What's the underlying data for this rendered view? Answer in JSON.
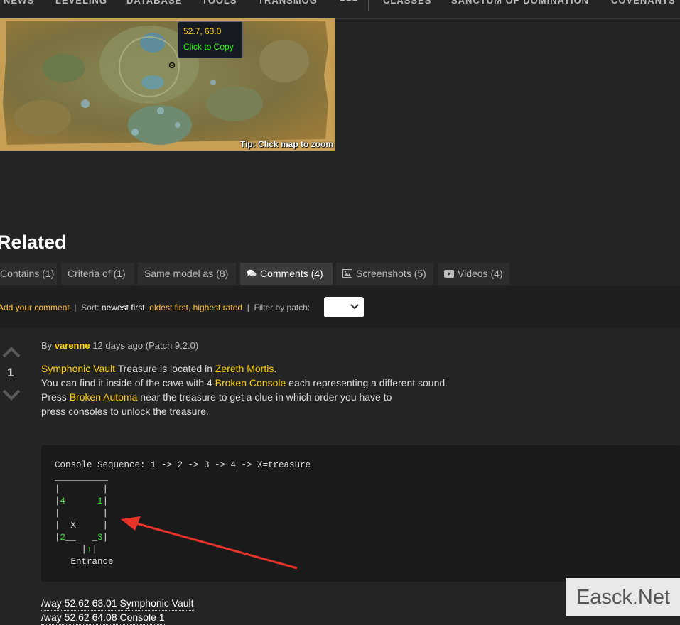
{
  "nav": {
    "items": [
      "NEWS",
      "LEVELING",
      "DATABASE",
      "TOOLS",
      "TRANSMOG",
      "CLASSES",
      "SANCTUM OF DOMINATION",
      "COVENANTS"
    ]
  },
  "map": {
    "tooltip_coords": "52.7, 63.0",
    "tooltip_action": "Click to Copy",
    "tip": "Tip: Click map to zoom"
  },
  "related": {
    "title": "Related",
    "tabs": [
      {
        "label": "Contains (1)",
        "icon": ""
      },
      {
        "label": "Criteria of (1)",
        "icon": ""
      },
      {
        "label": "Same model as (8)",
        "icon": ""
      },
      {
        "label": "Comments (4)",
        "icon": "comments-icon",
        "active": true
      },
      {
        "label": "Screenshots (5)",
        "icon": "image-icon"
      },
      {
        "label": "Videos (4)",
        "icon": "video-icon"
      }
    ]
  },
  "toolbar": {
    "add_comment": "Add your comment",
    "sort_label": "Sort:",
    "sort_newest": "newest first",
    "sort_oldest": "oldest first",
    "sort_highest": "highest rated",
    "filter_label": "Filter by patch:",
    "patch_value": ""
  },
  "comment": {
    "votes": "1",
    "by": "By",
    "author": "varenne",
    "meta": "12 days ago (Patch 9.2.0)",
    "lines": [
      {
        "parts": [
          {
            "t": "Symphonic Vault",
            "link": true
          },
          {
            "t": " Treasure is located in "
          },
          {
            "t": "Zereth Mortis",
            "link": true
          },
          {
            "t": "."
          }
        ]
      },
      {
        "parts": [
          {
            "t": "You can find it inside of the cave with 4 "
          },
          {
            "t": "Broken Console",
            "link": true
          },
          {
            "t": " each representing a different sound."
          }
        ]
      },
      {
        "parts": [
          {
            "t": "Press "
          },
          {
            "t": "Broken Automa",
            "link": true
          },
          {
            "t": " near the treasure to get a clue in which order you have to"
          }
        ]
      },
      {
        "parts": [
          {
            "t": "press consoles to unlock the treasure."
          }
        ]
      }
    ],
    "code_title": "Console Sequence: 1 -> 2 -> 3 -> 4 -> X=treasure",
    "way_lines": [
      "/way 52.62 63.01 Symphonic Vault",
      "/way 52.62 64.08 Console 1"
    ]
  },
  "watermark": "Easck.Net",
  "colors": {
    "background": "#242424",
    "gold": "#ffd100",
    "green": "#1eff00",
    "arrow": "#e8332a"
  }
}
